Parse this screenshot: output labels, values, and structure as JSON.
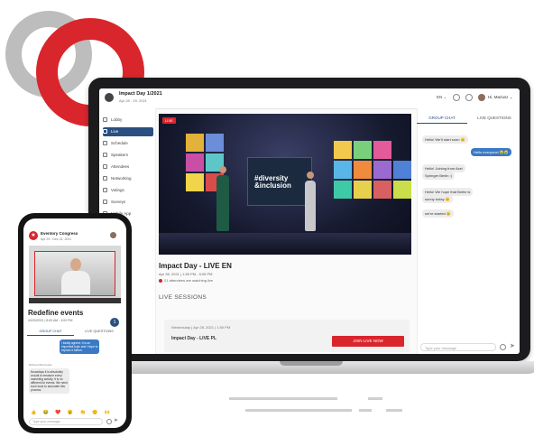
{
  "colors": {
    "accent": "#d9252c",
    "nav_active": "#2a4f80",
    "chat_out": "#3a79c4"
  },
  "header": {
    "title": "Impact Day 1/2021",
    "subtitle": "Apr 28 - 29, 2021",
    "language": "EN ⌄",
    "user": "Hi, Mariusz ⌄"
  },
  "sidebar": {
    "items": [
      {
        "label": "Lobby",
        "icon": "home-icon"
      },
      {
        "label": "Live",
        "icon": "tv-icon"
      },
      {
        "label": "Schedule",
        "icon": "calendar-icon"
      },
      {
        "label": "Speakers",
        "icon": "mic-icon"
      },
      {
        "label": "Attendees",
        "icon": "people-icon"
      },
      {
        "label": "Networking",
        "icon": "network-icon"
      },
      {
        "label": "Votings",
        "icon": "vote-icon"
      },
      {
        "label": "Surveys",
        "icon": "survey-icon"
      },
      {
        "label": "Mobile App",
        "icon": "phone-icon"
      }
    ]
  },
  "main": {
    "live_tag": "LIVE",
    "stage_text_1": "#diversity",
    "stage_text_2": "&inclusion",
    "event_title": "Impact Day - LIVE EN",
    "event_date": "Apr 28, 2021 | 1:55 PM - 5:05 PM",
    "watching": "21 attendees are watching live",
    "live_sessions": "LIVE SESSIONS",
    "session": {
      "date": "Wednesday | Apr 28, 2021 | 1:50 PM",
      "name": "Impact Day - LIVE PL",
      "button": "JOIN LIVE NOW"
    }
  },
  "chat": {
    "tabs": [
      "GROUP CHAT",
      "LIVE QUESTIONS"
    ],
    "messages": [
      {
        "text": "Hello! We'll start soon 😊",
        "dir": "in"
      },
      {
        "text": "Hello everyone! 😂😭",
        "dir": "out"
      },
      {
        "text": "Hello! Joining from Axel",
        "dir": "in"
      },
      {
        "text": "Springer Berlin :)",
        "dir": "in"
      },
      {
        "text": "Hello! We hope that Berlin is",
        "dir": "in"
      },
      {
        "text": "sunny today 😊",
        "dir": "in"
      },
      {
        "text": "we're started 😊",
        "dir": "in"
      }
    ],
    "input_placeholder": "Type your message"
  },
  "phone": {
    "app_title": "Eventory Congress",
    "app_dates": "Apr 29 - Dec 31, 2021",
    "event_title": "Redefine events",
    "event_date": "04/29/2021 | 8:00 AM - 4:00 PM",
    "badge": "1",
    "tabs": [
      "GROUP CHAT",
      "LIVE QUESTIONS"
    ],
    "msg_out": [
      "I totally agreed. It is an",
      "important topic and I hope to",
      "explore it further."
    ],
    "sender": "Barbara Bartowska",
    "msg_in": [
      "Nowadays it is absolutely",
      "crucial to measure every",
      "marketing activity. It is no",
      "different for events. We need",
      "such tools to automate this",
      "process."
    ],
    "emojis": "👍 😂 ❤️ 😮 👏 😊 🙌",
    "input_placeholder": "Type your message"
  }
}
